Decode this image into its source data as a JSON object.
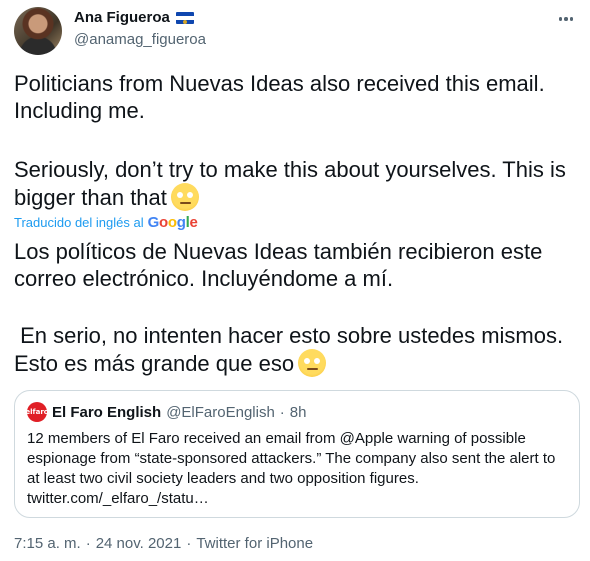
{
  "author": {
    "display_name": "Ana Figueroa",
    "handle": "@anamag_figueroa",
    "flag_icon": "el-salvador-flag-icon"
  },
  "tweet": {
    "paragraph1": "Politicians from Nuevas Ideas also received this email. Including me.",
    "paragraph2": "Seriously, don’t try to make this about yourselves. This is bigger than that",
    "translate_label": "Traducido del inglés al",
    "translate_provider": [
      "G",
      "o",
      "o",
      "g",
      "l",
      "e"
    ],
    "paragraph3": "Los políticos de Nuevas Ideas también recibieron este correo electrónico. Incluyéndome a mí.",
    "paragraph4": " En serio, no intenten hacer esto sobre ustedes mismos. Esto es más grande que eso",
    "emoji_icon": "face-with-rolling-eyes-icon"
  },
  "quote": {
    "avatar_text": "elfaro",
    "name": "El Faro English",
    "handle": "@ElFaroEnglish",
    "separator": "·",
    "time": "8h",
    "body": "12 members of El Faro received an email from @Apple warning of possible espionage from “state-sponsored attackers.” The company also sent the alert to at least two civil society leaders and two opposition figures. twitter.com/_elfaro_/statu…"
  },
  "meta": {
    "time": "7:15 a. m.",
    "sep1": "·",
    "date": "24 nov. 2021",
    "sep2": "·",
    "source": "Twitter for iPhone"
  },
  "colors": {
    "link": "#1d9bf0",
    "secondary_text": "#536471",
    "border": "#cfd9de"
  }
}
